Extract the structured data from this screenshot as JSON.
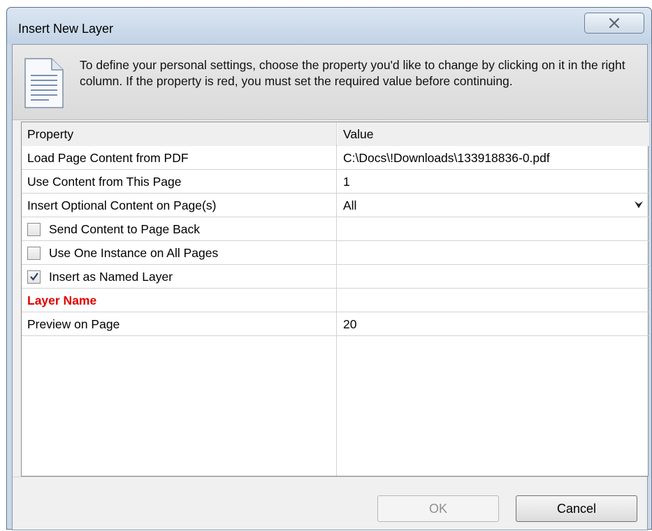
{
  "window": {
    "title": "Insert New Layer"
  },
  "info": {
    "text": "To define your personal settings, choose the property you'd like to change by clicking on it in the right column. If the property is red, you must set the required value before continuing."
  },
  "grid": {
    "headers": {
      "property": "Property",
      "value": "Value"
    },
    "rows": [
      {
        "label": "Load Page Content from PDF",
        "value": "C:\\Docs\\!Downloads\\133918836-0.pdf"
      },
      {
        "label": "Use Content from This Page",
        "value": "1"
      },
      {
        "label": "Insert Optional Content on Page(s)",
        "value": "All"
      },
      {
        "label": "Send Content to Page Back",
        "checked": false
      },
      {
        "label": "Use One Instance on All Pages",
        "checked": false
      },
      {
        "label": "Insert as Named Layer",
        "checked": true
      },
      {
        "label": "Layer Name",
        "value": "",
        "required": true,
        "color": "#e00000"
      },
      {
        "label": "Preview on Page",
        "value": "20"
      }
    ]
  },
  "buttons": {
    "ok": "OK",
    "cancel": "Cancel"
  },
  "icons": {
    "close": "close-x-icon",
    "document": "document-icon",
    "dropdown": "dropdown-arrow-icon",
    "check": "checkmark-icon"
  }
}
